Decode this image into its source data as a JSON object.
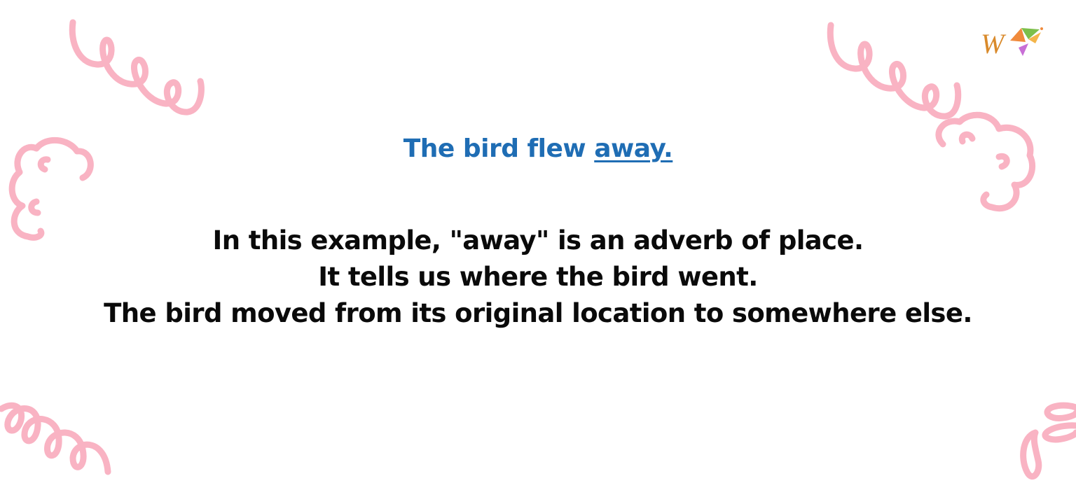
{
  "brand": {
    "logo_initial": "W",
    "colors": {
      "logo_gold": "#d98a2b",
      "logo_orange": "#f08a3c",
      "logo_green": "#7cbf4a",
      "logo_purple": "#c86fd6"
    }
  },
  "decor": {
    "doodle_color": "#f9b3c3",
    "icons": [
      "squiggle-loop-icon",
      "cloud-swirl-icon",
      "squiggle-loop-icon",
      "cloud-swirl-icon",
      "squiggle-loop-icon",
      "leaf-loop-icon"
    ]
  },
  "example": {
    "sentence_start": "The bird flew ",
    "highlighted_word": "away.",
    "color": "#1f6db4"
  },
  "explanation": {
    "lines": [
      "In this example, \"away\" is an adverb of place.",
      "It tells us where the bird went.",
      "The bird moved from its original location to somewhere else."
    ],
    "color": "#0a0a0a"
  }
}
